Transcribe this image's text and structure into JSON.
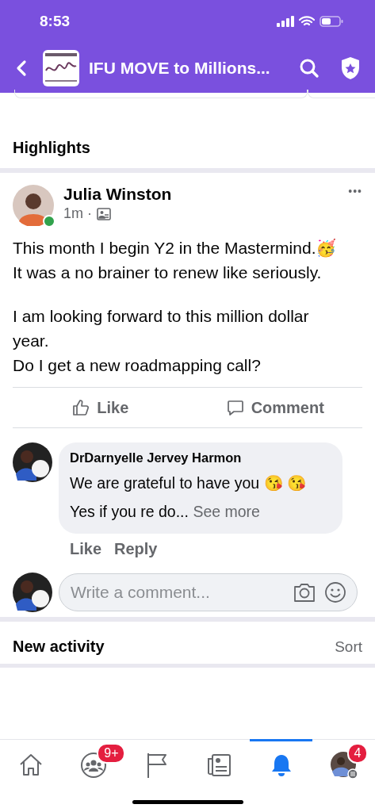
{
  "status_bar": {
    "time": "8:53"
  },
  "header": {
    "title": "IFU MOVE to Millions..."
  },
  "section_title": "Highlights",
  "post": {
    "author": "Julia Winston",
    "online": true,
    "time": "1m ·",
    "menu": "•••",
    "paragraphs": [
      "This month I begin Y2 in the Mastermind.🥳 It was a no brainer to renew like seriously.",
      "I am looking forward to this million dollar year.\nDo I get a new roadmapping call?"
    ],
    "actions": [
      {
        "kind": "like",
        "label": "Like"
      },
      {
        "kind": "comment",
        "label": "Comment"
      }
    ]
  },
  "comment": {
    "author": "DrDarnyelle Jervey Harmon",
    "text": "We are grateful to have you 😘 😘 Yes if you re do...",
    "see_more": "See more",
    "actions": [
      "Like",
      "Reply"
    ]
  },
  "composer": {
    "placeholder": "Write a comment..."
  },
  "activity": {
    "title": "New activity",
    "sort": "Sort"
  },
  "tabs": [
    {
      "kind": "home",
      "selected": false
    },
    {
      "kind": "groups",
      "selected": false,
      "badge": "9+"
    },
    {
      "kind": "pages",
      "selected": false
    },
    {
      "kind": "news",
      "selected": false
    },
    {
      "kind": "notifications",
      "selected": true
    },
    {
      "kind": "menu",
      "selected": false,
      "badge": "4"
    }
  ]
}
